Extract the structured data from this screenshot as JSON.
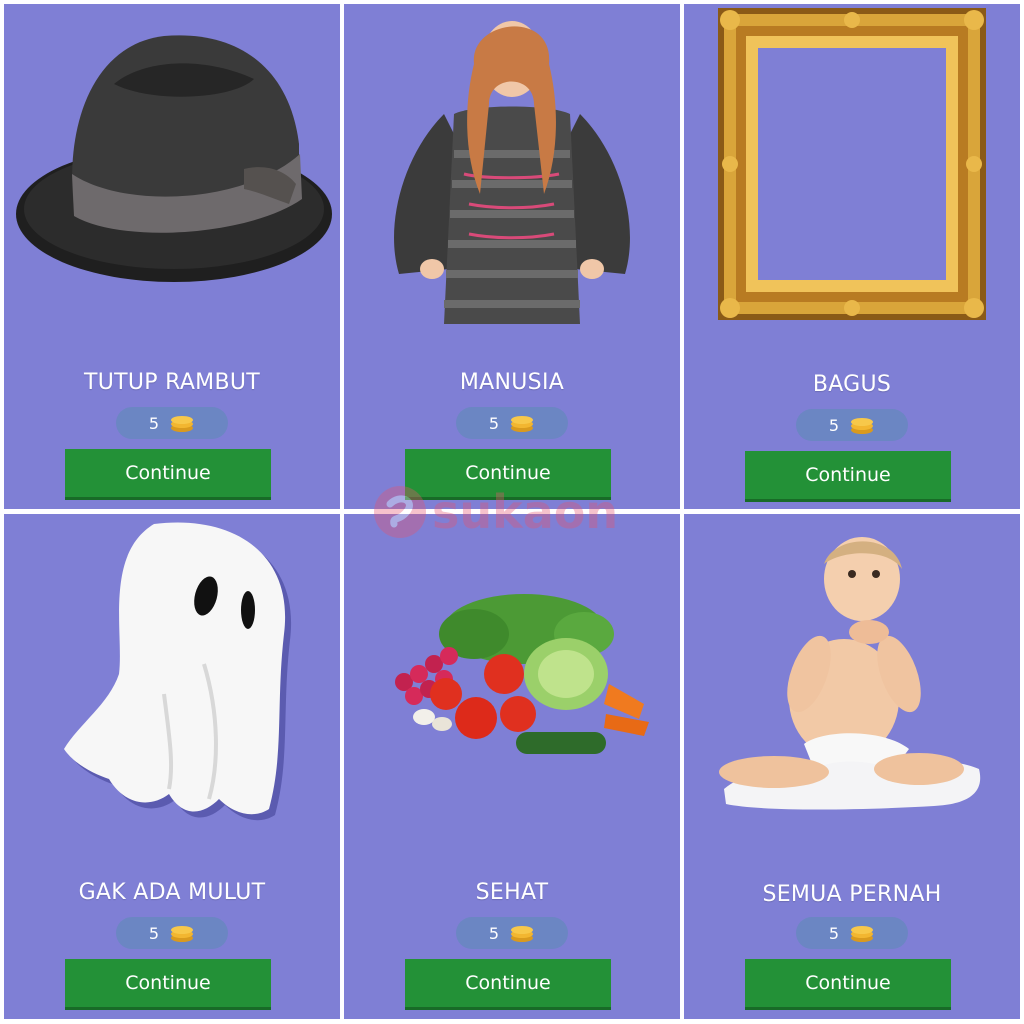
{
  "levels": [
    {
      "title": "TUTUP RAMBUT",
      "cost": "5",
      "button": "Continue",
      "image": "fedora-hat-icon"
    },
    {
      "title": "MANUSIA",
      "cost": "5",
      "button": "Continue",
      "image": "girl-photo"
    },
    {
      "title": "BAGUS",
      "cost": "5",
      "button": "Continue",
      "image": "gold-frame-icon"
    },
    {
      "title": "GAK ADA MULUT",
      "cost": "5",
      "button": "Continue",
      "image": "ghost-icon"
    },
    {
      "title": "SEHAT",
      "cost": "5",
      "button": "Continue",
      "image": "vegetables-icon"
    },
    {
      "title": "SEMUA PERNAH",
      "cost": "5",
      "button": "Continue",
      "image": "baby-photo"
    }
  ],
  "watermark": {
    "text": "sukaon"
  },
  "colors": {
    "tile_bg": "#7f7fd5",
    "price_pill": "#6b86c3",
    "continue_button": "#239137",
    "coin": "#f2b630"
  }
}
